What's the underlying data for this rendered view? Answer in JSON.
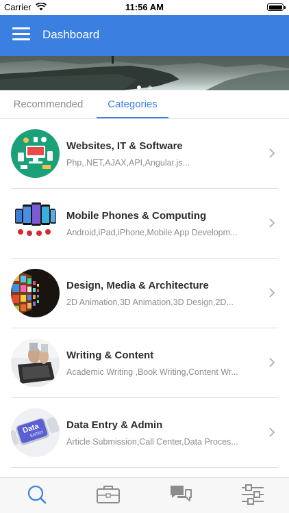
{
  "status_bar": {
    "carrier": "Carrier",
    "time": "11:56 AM"
  },
  "app_bar": {
    "title": "Dashboard",
    "menu_icon": "hamburger-menu-icon"
  },
  "banner": {
    "slides": 2,
    "active_slide": 1
  },
  "tabs": [
    {
      "label": "Recommended",
      "selected": false
    },
    {
      "label": "Categories",
      "selected": true
    }
  ],
  "categories": [
    {
      "title": "Websites, IT & Software",
      "subtitle": "Php,.NET,AJAX,API,Angular.js...",
      "icon": "websites-it-thumbnail"
    },
    {
      "title": "Mobile Phones & Computing",
      "subtitle": "Android,iPad,iPhone,Mobile App Developm...",
      "icon": "mobile-phones-thumbnail"
    },
    {
      "title": "Design, Media & Architecture",
      "subtitle": "2D Animation,3D Animation,3D Design,2D...",
      "icon": "design-media-thumbnail"
    },
    {
      "title": "Writing & Content",
      "subtitle": "Academic Writing ,Book Writing,Content Wr...",
      "icon": "writing-content-thumbnail"
    },
    {
      "title": "Data Entry & Admin",
      "subtitle": "Article Submission,Call Center,Data Proces...",
      "icon": "data-entry-thumbnail"
    }
  ],
  "data_entry_key": {
    "line1": "Data",
    "line2": "ENTRY"
  },
  "tab_bar": [
    {
      "icon": "search-icon",
      "active": true
    },
    {
      "icon": "briefcase-icon",
      "active": false
    },
    {
      "icon": "chat-bubbles-icon",
      "active": false
    },
    {
      "icon": "sliders-icon",
      "active": false
    }
  ],
  "colors": {
    "primary": "#3b7fe1",
    "tab_inactive": "#8a8a8a",
    "icon_inactive": "#8c8c8c"
  }
}
